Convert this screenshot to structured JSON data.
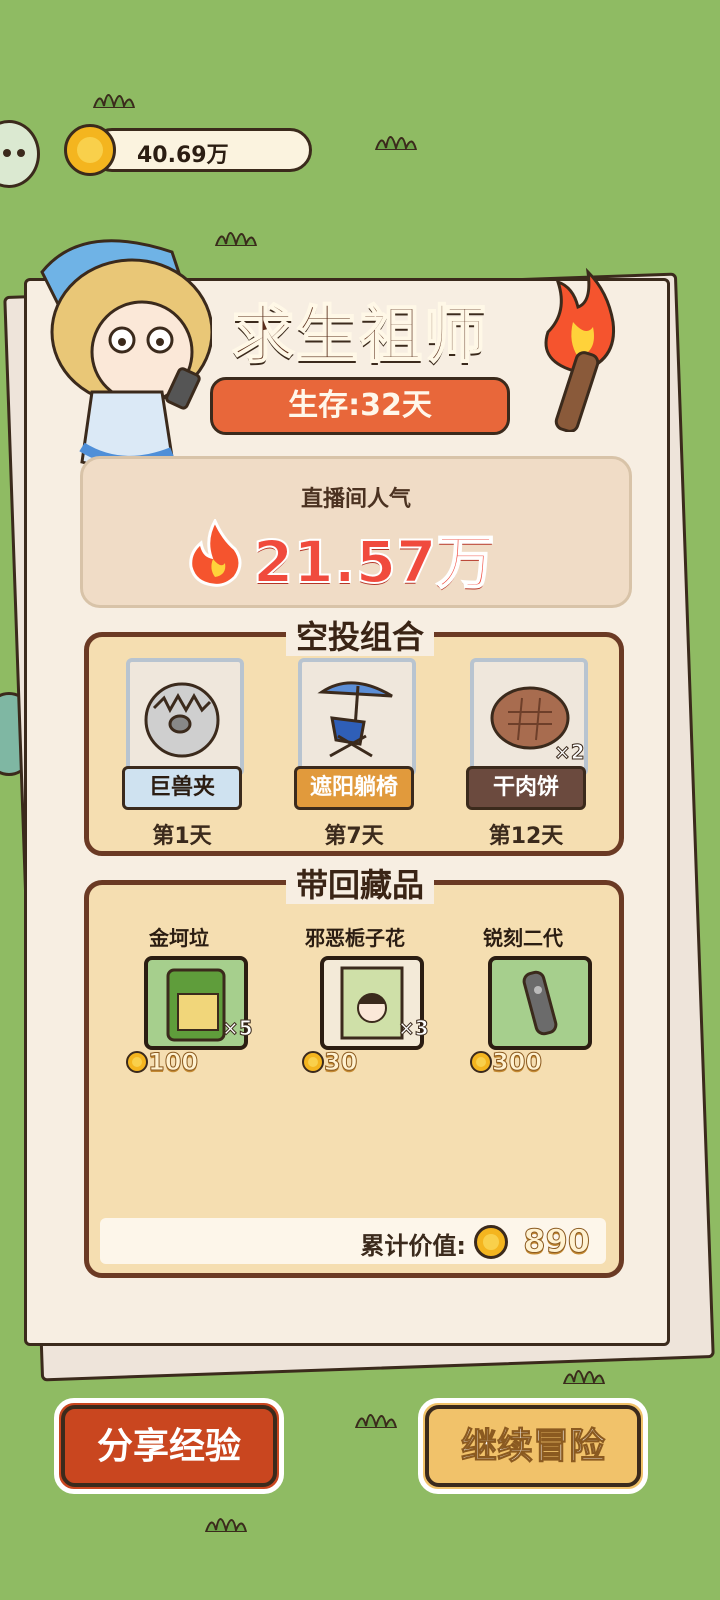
{
  "coins": {
    "value": "40.69万",
    "icon": "coin-icon"
  },
  "title": "求生祖师",
  "survival": "生存:32天",
  "popularity": {
    "label": "直播间人气",
    "value": "21.57万",
    "icon": "flame-icon"
  },
  "airdrop": {
    "title": "空投组合",
    "items": [
      {
        "name": "巨兽夹",
        "day": "第1天",
        "qty": "",
        "tag_color": "#cfe2f0",
        "text_color": "#2b1d12",
        "icon": "beast-trap-icon"
      },
      {
        "name": "遮阳躺椅",
        "day": "第7天",
        "qty": "",
        "tag_color": "#e19a3c",
        "text_color": "#fff",
        "icon": "beach-chair-icon"
      },
      {
        "name": "干肉饼",
        "day": "第12天",
        "qty": "×2",
        "tag_color": "#6b4a3e",
        "text_color": "#fff",
        "icon": "jerky-patty-icon"
      }
    ]
  },
  "collectibles": {
    "title": "带回藏品",
    "items": [
      {
        "name": "金坷垃",
        "qty": "×5",
        "price": "100",
        "icon": "fertilizer-bag-icon"
      },
      {
        "name": "邪恶栀子花",
        "qty": "×3",
        "price": "30",
        "icon": "poster-icon"
      },
      {
        "name": "锐刻二代",
        "qty": "",
        "price": "300",
        "icon": "e-cigarette-icon"
      }
    ],
    "total_label": "累计价值:",
    "total_value": "890"
  },
  "buttons": {
    "share": "分享经验",
    "continue": "继续冒险"
  },
  "colors": {
    "background": "#8fbb63",
    "share": "#c9461f",
    "continue": "#f1c26a",
    "popularity": "#f04a3d"
  }
}
